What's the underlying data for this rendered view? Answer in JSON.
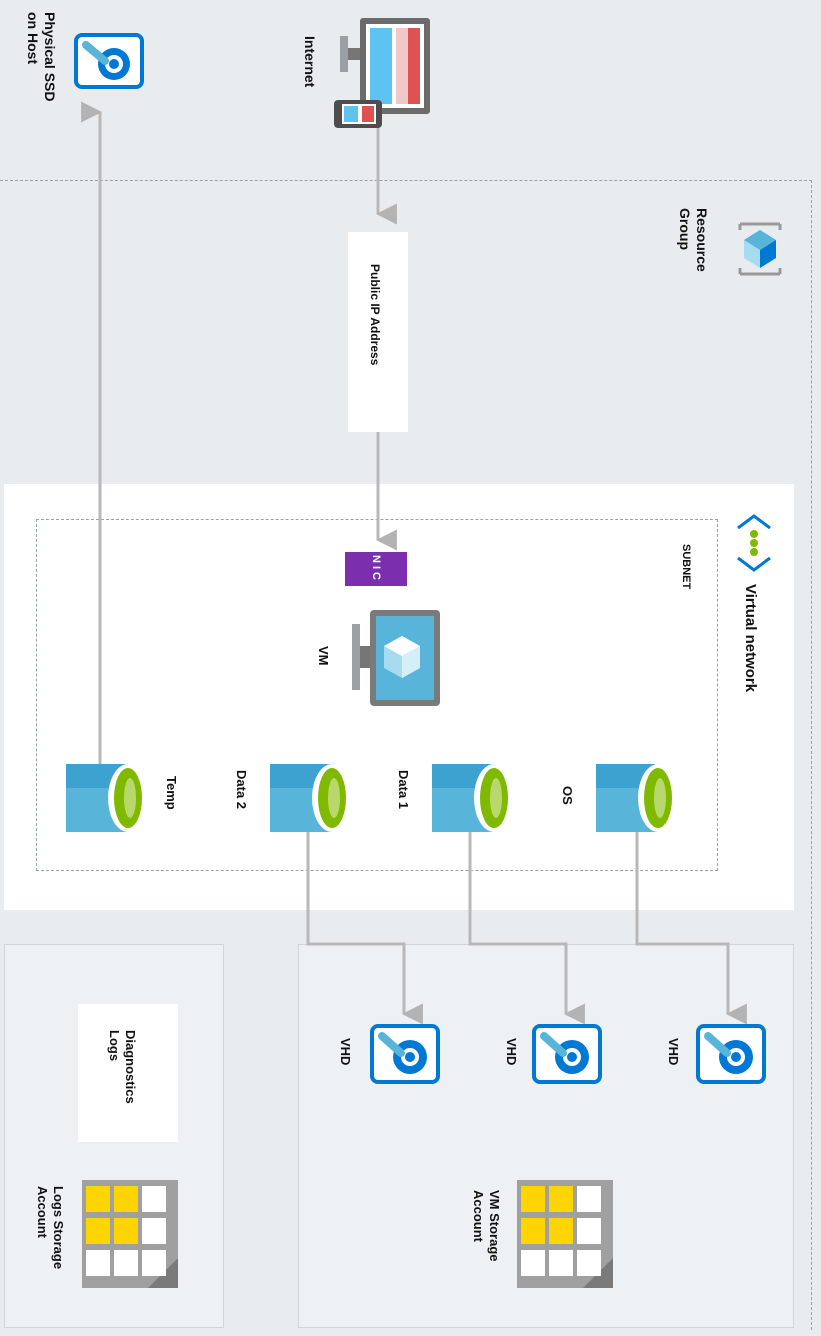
{
  "internet": {
    "label": "Internet"
  },
  "physical_ssd": {
    "label_line1": "Physical SSD",
    "label_line2": "on Host"
  },
  "resource_group": {
    "label_line1": "Resource",
    "label_line2": "Group"
  },
  "public_ip": {
    "label": "Public IP Address"
  },
  "virtual_network": {
    "label": "Virtual network"
  },
  "subnet": {
    "label": "SUBNET"
  },
  "nic": {
    "label": "NIC"
  },
  "vm": {
    "label": "VM"
  },
  "disks": {
    "os": "OS",
    "data1": "Data 1",
    "data2": "Data 2",
    "temp": "Temp"
  },
  "vm_storage": {
    "label_line1": "VM Storage",
    "label_line2": "Account",
    "vhd1": "VHD",
    "vhd2": "VHD",
    "vhd3": "VHD"
  },
  "logs_storage": {
    "label_line1": "Logs Storage",
    "label_line2": "Account",
    "diagnostics_line1": "Diagnostics",
    "diagnostics_line2": "Logs"
  },
  "colors": {
    "azure_blue": "#0078d4",
    "disk_blue": "#59b4d9",
    "disk_green": "#7fba00",
    "nic_purple": "#7b2fae",
    "storage_yellow": "#ffd400"
  }
}
